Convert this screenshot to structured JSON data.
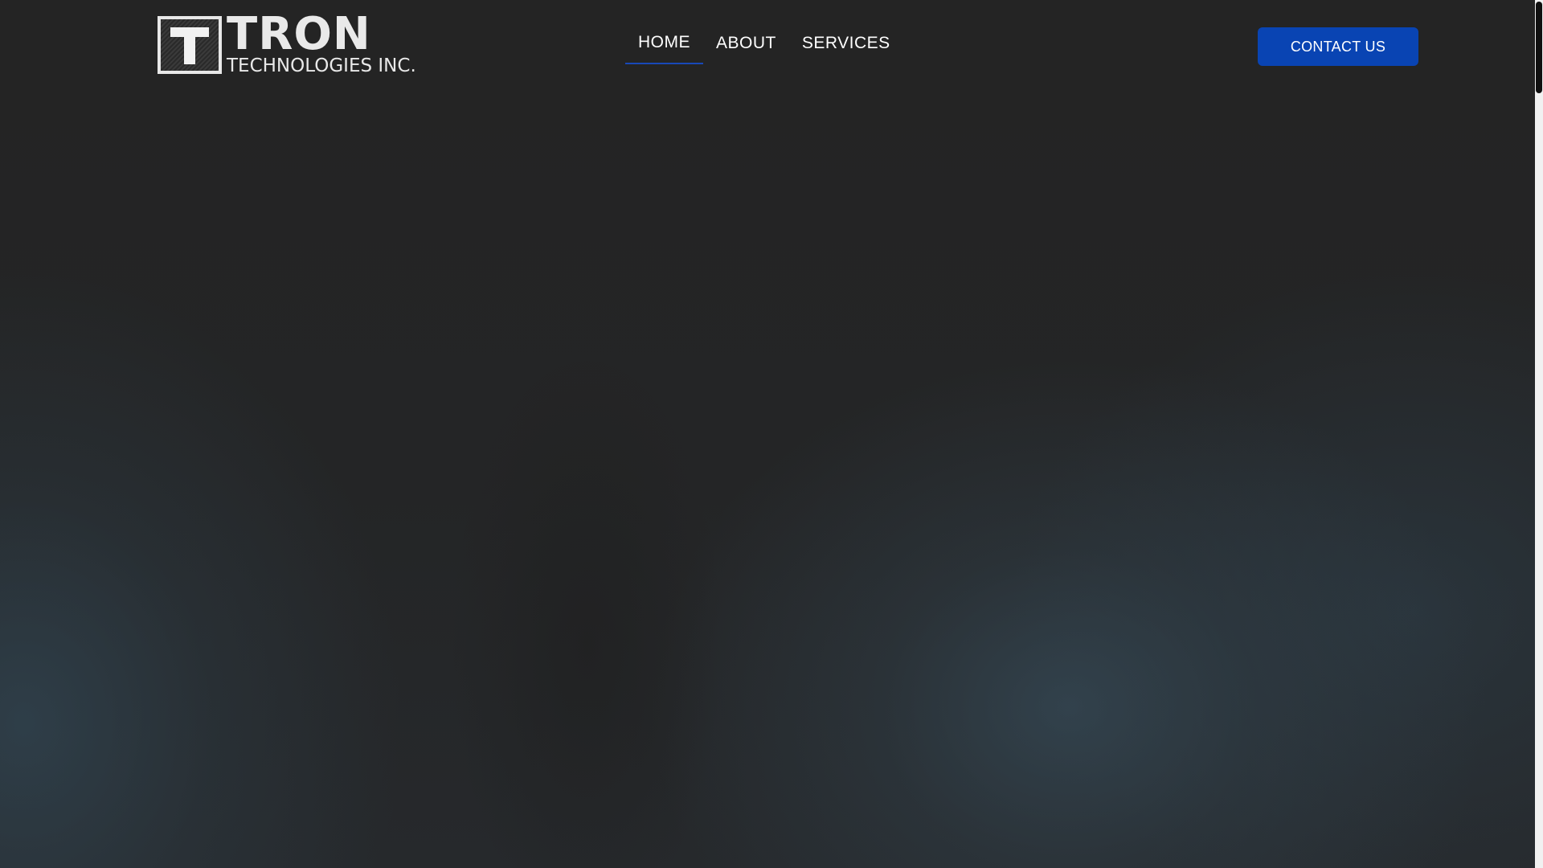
{
  "logo": {
    "mark_letter": "T",
    "name": "TRON",
    "subtitle": "TECHNOLOGIES INC."
  },
  "nav": {
    "items": [
      {
        "label": "HOME",
        "active": true
      },
      {
        "label": "ABOUT",
        "active": false
      },
      {
        "label": "SERVICES",
        "active": false
      }
    ]
  },
  "header": {
    "cta_label": "CONTACT US"
  },
  "colors": {
    "background": "#232323",
    "accent": "#0944b3",
    "nav_active_underline": "#1848b8",
    "text": "#ffffff"
  }
}
